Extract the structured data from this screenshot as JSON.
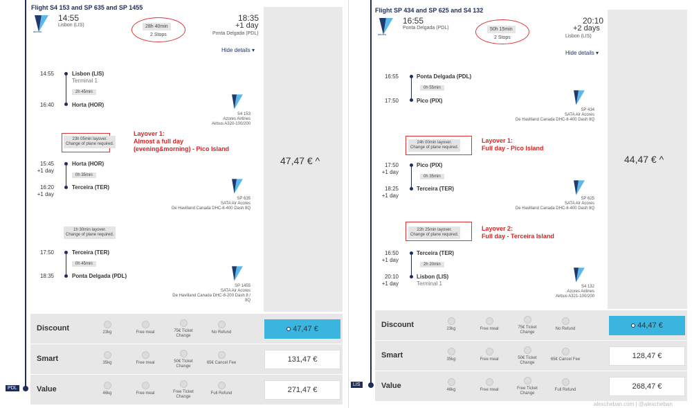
{
  "left": {
    "title": "Flight S4 153 and SP 635 and SP 1455",
    "dep_time": "14:55",
    "dep_city": "Lisbon (LIS)",
    "duration": "28h 40min",
    "stops": "2 Stops",
    "arr_time": "18:35",
    "arr_plus": "+1 day",
    "arr_city": "Ponta Delgada (PDL)",
    "hide_details": "Hide details ▾",
    "price": "47,47 € ^",
    "code_tag": "PDL",
    "segments": [
      {
        "t1": "14:55",
        "a1": "Lisbon (LIS)",
        "s1": "Terminal 1",
        "dur": "2h 45min",
        "t2": "16:40",
        "a2": "Horta (HOR)",
        "flight": "S4 153",
        "airline": "Azores Airlines",
        "aircraft": "Airbus A320-100/200"
      },
      {
        "t1": "15:45 +1 day",
        "a1": "Horta (HOR)",
        "dur": "0h 35min",
        "t2": "16:20 +1 day",
        "a2": "Terceira (TER)",
        "flight": "SP 635",
        "airline": "SATA Air Acores",
        "aircraft": "De Havilland Canada DHC-8-400 Dash 8Q"
      },
      {
        "t1": "17:50",
        "a1": "Terceira (TER)",
        "dur": "0h 45min",
        "t2": "18:35",
        "a2": "Ponta Delgada (PDL)",
        "flight": "SP 1455",
        "airline": "SATA Air Acores",
        "aircraft": "De Havilland Canada DHC-8-200 Dash 8 / 8Q"
      }
    ],
    "layovers": [
      {
        "line1": "23h 05min layover.",
        "line2": "Change of plane required."
      },
      {
        "line1": "1h 30min layover.",
        "line2": "Change of plane required."
      }
    ],
    "annotation1": {
      "a": "Layover 1:",
      "b": "Almost a full day",
      "c": "(evening&morning) - Pico Island"
    },
    "fares": [
      {
        "name": "Discount",
        "f1": "23kg",
        "f2": "Free meal",
        "f3": "75€ Ticket Change",
        "f4": "No Refund",
        "price": "47,47 €"
      },
      {
        "name": "Smart",
        "f1": "35kg",
        "f2": "Free meal",
        "f3": "50€ Ticket Change",
        "f4": "65€ Cancel Fee",
        "price": "131,47 €"
      },
      {
        "name": "Value",
        "f1": "46kg",
        "f2": "Free meal",
        "f3": "Free Ticket Change",
        "f4": "Full Refund",
        "price": "271,47 €"
      }
    ]
  },
  "right": {
    "title": "Flight SP 434 and SP 625 and S4 132",
    "dep_time": "16:55",
    "dep_city": "Ponta Delgada (PDL)",
    "duration": "50h 15min",
    "stops": "2 Stops",
    "arr_time": "20:10",
    "arr_plus": "+2 days",
    "arr_city": "Lisbon (LIS)",
    "hide_details": "Hide details ▾",
    "price": "44,47 € ^",
    "code_tag": "LIS",
    "segments": [
      {
        "t1": "16:55",
        "a1": "Ponta Delgada (PDL)",
        "dur": "0h 55min",
        "t2": "17:50",
        "a2": "Pico (PIX)",
        "flight": "SP 434",
        "airline": "SATA Air Acores",
        "aircraft": "De Havilland Canada DHC-8-400 Dash 8Q"
      },
      {
        "t1": "17:50 +1 day",
        "a1": "Pico (PIX)",
        "dur": "0h 35min",
        "t2": "18:25 +1 day",
        "a2": "Terceira (TER)",
        "flight": "SP 625",
        "airline": "SATA Air Acores",
        "aircraft": "De Havilland Canada DHC-8-400 Dash 8Q"
      },
      {
        "t1": "16:50 +1 day",
        "a1": "Terceira (TER)",
        "dur": "2h 20min",
        "t2": "20:10 +1 day",
        "a2": "Lisbon (LIS)",
        "s2": "Terminal 1",
        "flight": "S4 132",
        "airline": "Azores Airlines",
        "aircraft": "Airbus A321-100/200"
      }
    ],
    "layovers": [
      {
        "line1": "24h 00min layover.",
        "line2": "Change of plane required."
      },
      {
        "line1": "22h 25min layover.",
        "line2": "Change of plane required."
      }
    ],
    "annotation1": {
      "a": "Layover 1:",
      "b": "Full day - Pico Island"
    },
    "annotation2": {
      "a": "Layover 2:",
      "b": "Full day - Terceira Island"
    },
    "fares": [
      {
        "name": "Discount",
        "f1": "23kg",
        "f2": "Free meal",
        "f3": "75€ Ticket Change",
        "f4": "No Refund",
        "price": "44,47 €"
      },
      {
        "name": "Smart",
        "f1": "35kg",
        "f2": "Free meal",
        "f3": "50€ Ticket Change",
        "f4": "65€ Cancel Fee",
        "price": "128,47 €"
      },
      {
        "name": "Value",
        "f1": "46kg",
        "f2": "Free meal",
        "f3": "Free Ticket Change",
        "f4": "Full Refund",
        "price": "268,47 €"
      }
    ]
  },
  "watermark": "alexcheban.com | @alexcheban"
}
